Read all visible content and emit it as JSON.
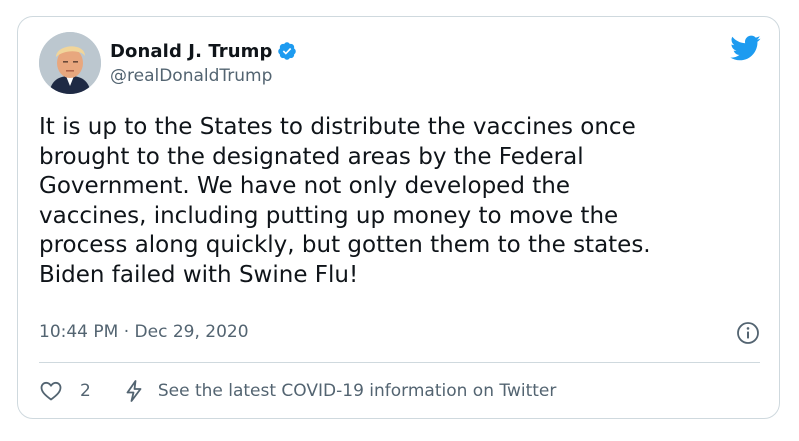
{
  "author": {
    "display_name": "Donald J. Trump",
    "handle": "@realDonaldTrump",
    "verified": true,
    "avatar": "profile-photo"
  },
  "tweet": {
    "text": "It is up to the States to distribute the vaccines once\nbrought to the designated areas by the Federal\nGovernment. We have not only developed the\nvaccines, including putting up money to move the\nprocess along quickly, but gotten them to the states.\nBiden failed with Swine Flu!",
    "timestamp": "10:44 PM · Dec 29, 2020"
  },
  "actions": {
    "like_count": "2",
    "covid_info_label": "See the latest COVID-19 information on Twitter"
  },
  "icons": {
    "brand": "twitter-bird-icon",
    "verified": "verified-badge-icon",
    "info": "info-icon",
    "like": "heart-icon",
    "info_link": "lightning-bolt-icon"
  },
  "colors": {
    "twitter_blue": "#1d9bf0",
    "text_primary": "#0f1419",
    "text_secondary": "#536471",
    "border": "#cfd9de"
  }
}
